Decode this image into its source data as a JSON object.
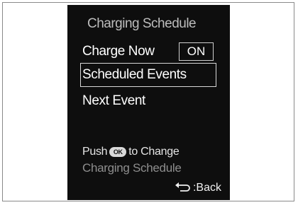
{
  "screen": {
    "title": "Charging Schedule",
    "items": [
      {
        "label": "Charge Now",
        "value": "ON"
      },
      {
        "label": "Scheduled Events"
      },
      {
        "label": "Next Event"
      }
    ],
    "hint": {
      "prefix": "Push",
      "ok_label": "OK",
      "suffix": "to Change",
      "line2": "Charging Schedule"
    },
    "back_label": ":Back"
  },
  "colors": {
    "screen_bg": "#0e0e0e",
    "text": "#ffffff",
    "title": "#bdbdbd",
    "dim_text": "#8e8e8e"
  }
}
